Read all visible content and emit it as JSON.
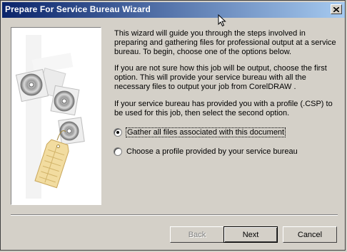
{
  "window": {
    "title": "Prepare For Service Bureau Wizard",
    "close_icon": "close-icon"
  },
  "content": {
    "intro": "This wizard will guide you through the steps involved in preparing and gathering files for professional output at a service bureau. To begin, choose one of the options below.",
    "not_sure": "If you are not sure how this job will be output, choose the first option. This will provide your service bureau with all the necessary files to output your job from CorelDRAW .",
    "profile_info": "If your service bureau has provided you with a profile (.CSP) to be used for this job, then select the second option."
  },
  "options": [
    {
      "label": "Gather all files associated with this document",
      "selected": true
    },
    {
      "label": "Choose a profile provided by your service bureau",
      "selected": false
    }
  ],
  "buttons": {
    "back": "Back",
    "next": "Next",
    "cancel": "Cancel"
  }
}
